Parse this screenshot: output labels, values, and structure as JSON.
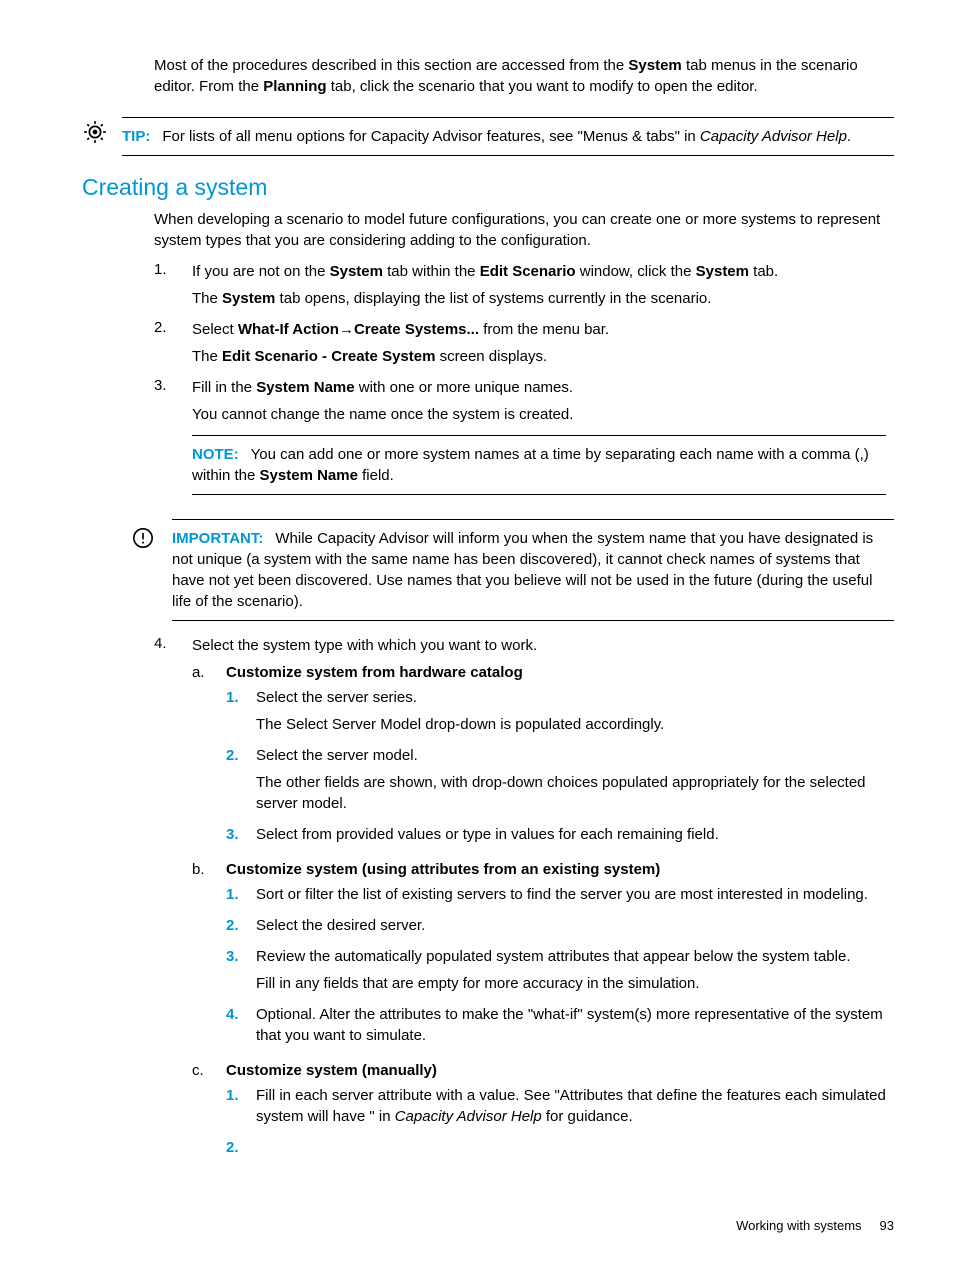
{
  "intro": {
    "text_before_system": "Most of the procedures described in this section are accessed from the ",
    "system": "System",
    "text_mid": " tab menus in the scenario editor. From the ",
    "planning": "Planning",
    "text_after": " tab, click the scenario that you want to modify to open the editor."
  },
  "tip": {
    "label": "TIP:",
    "text_before": "For lists of all menu options for Capacity Advisor features, see \"Menus & tabs\" in ",
    "italic": "Capacity Advisor Help",
    "text_after": "."
  },
  "section": {
    "title": "Creating a system"
  },
  "lead": "When developing a scenario to model future configurations, you can create one or more systems to represent system types that you are considering adding to the configuration.",
  "steps": {
    "s1_num": "1.",
    "s1_a": "If you are not on the ",
    "s1_b": "System",
    "s1_c": " tab within the ",
    "s1_d": "Edit Scenario",
    "s1_e": " window, click the ",
    "s1_f": "System",
    "s1_g": " tab.",
    "s1_p2a": "The ",
    "s1_p2b": "System",
    "s1_p2c": " tab opens, displaying the list of systems currently in the scenario.",
    "s2_num": "2.",
    "s2_a": "Select ",
    "s2_b": "What-If Action",
    "s2_arrow": "→",
    "s2_c": "Create Systems...",
    "s2_d": " from the menu bar.",
    "s2_p2a": "The ",
    "s2_p2b": "Edit Scenario - Create System",
    "s2_p2c": " screen displays.",
    "s3_num": "3.",
    "s3_a": "Fill in the ",
    "s3_b": "System Name",
    "s3_c": " with one or more unique names.",
    "s3_p2": "You cannot change the name once the system is created.",
    "note_label": "NOTE:",
    "note_a": "You can add one or more system names at a time by separating each name with a comma (,) within the ",
    "note_b": "System Name",
    "note_c": " field.",
    "imp_label": "IMPORTANT:",
    "imp_text": "While Capacity Advisor will inform you when the system name that you have designated is not unique (a system with the same name has been discovered), it cannot check names of systems that have not yet been discovered. Use names that you believe will not be used in the future (during the useful life of the scenario).",
    "s4_num": "4.",
    "s4_text": "Select the system type with which you want to work.",
    "a_marker": "a.",
    "a_title": "Customize system from hardware catalog",
    "a1_m": "1.",
    "a1_t": "Select the server series.",
    "a1_p2": "The Select Server Model drop-down is populated accordingly.",
    "a2_m": "2.",
    "a2_t": "Select the server model.",
    "a2_p2": "The other fields are shown, with drop-down choices populated appropriately for the selected server model.",
    "a3_m": "3.",
    "a3_t": "Select from provided values or type in values for each remaining field.",
    "b_marker": "b.",
    "b_title": "Customize system (using attributes from an existing system)",
    "b1_m": "1.",
    "b1_t": "Sort or filter the list of existing servers to find the server you are most interested in modeling.",
    "b2_m": "2.",
    "b2_t": "Select the desired server.",
    "b3_m": "3.",
    "b3_t": "Review the automatically populated system attributes that appear below the system table.",
    "b3_p2": "Fill in any fields that are empty for more accuracy in the simulation.",
    "b4_m": "4.",
    "b4_t": "Optional. Alter the attributes to make the \"what-if\" system(s) more representative of the system that you want to simulate.",
    "c_marker": "c.",
    "c_title": "Customize system (manually)",
    "c1_m": "1.",
    "c1_a": "Fill in each server attribute with a value. See \"Attributes that define the features each simulated system will have \" in ",
    "c1_b": "Capacity Advisor Help",
    "c1_c": " for guidance.",
    "c2_m": "2."
  },
  "footer": {
    "text": "Working with systems",
    "page": "93"
  }
}
